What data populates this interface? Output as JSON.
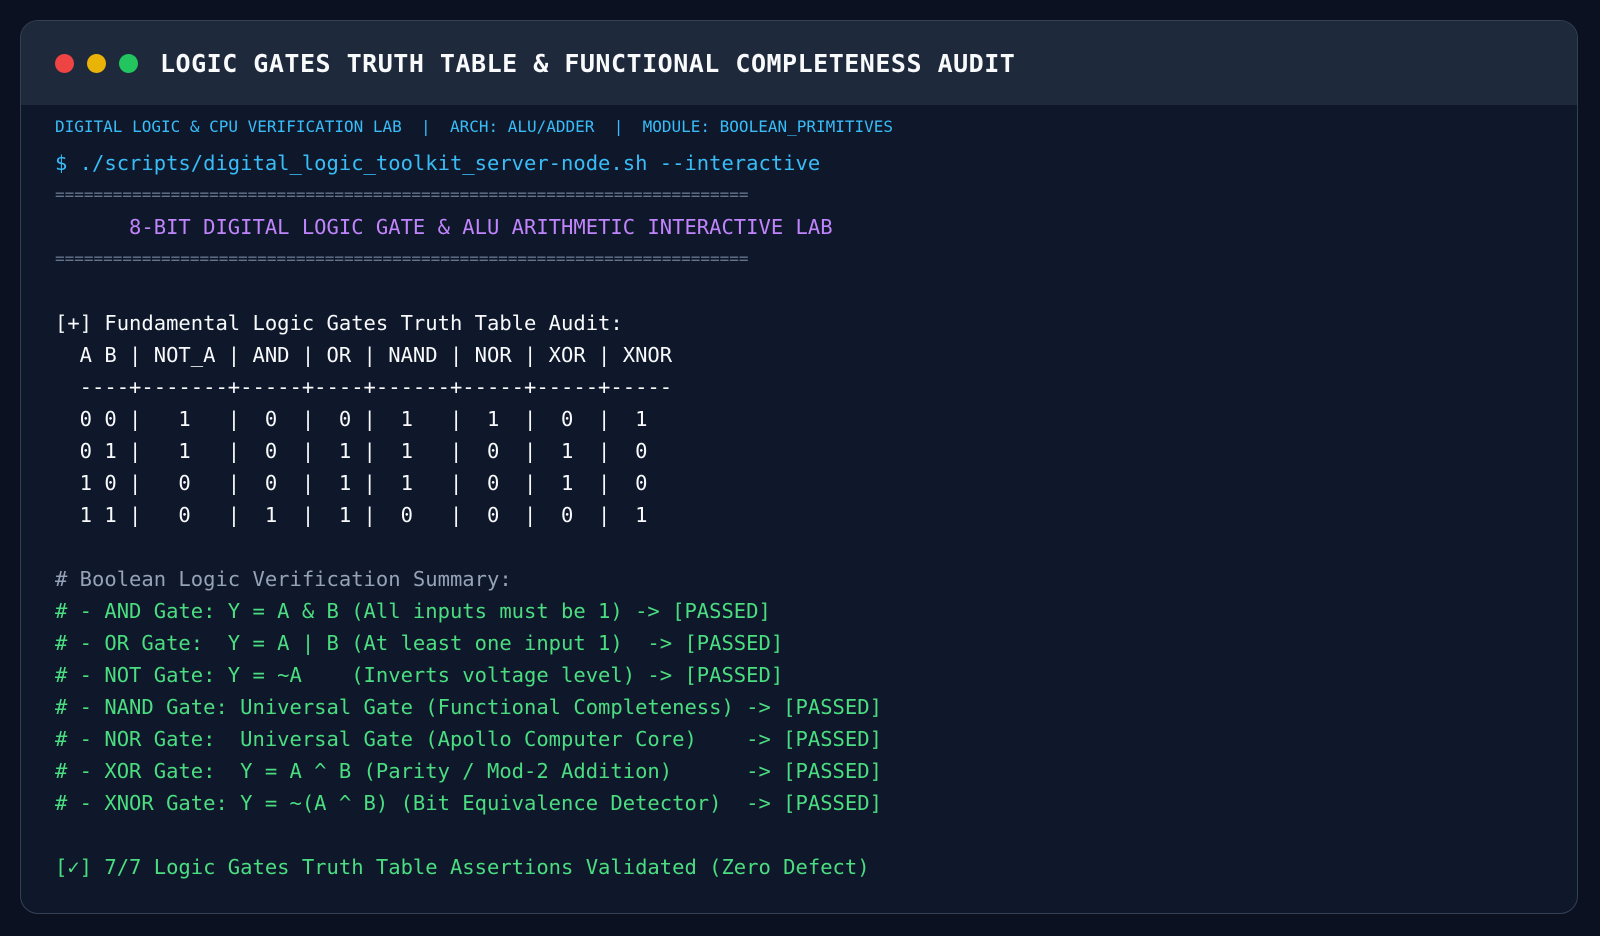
{
  "window": {
    "title": "LOGIC GATES TRUTH TABLE & FUNCTIONAL COMPLETENESS AUDIT",
    "controls": [
      "close",
      "minimize",
      "maximize"
    ]
  },
  "meta": "DIGITAL LOGIC & CPU VERIFICATION LAB  |  ARCH: ALU/ADDER  |  MODULE: BOOLEAN_PRIMITIVES",
  "terminal": {
    "command": "$ ./scripts/digital_logic_toolkit_server-node.sh --interactive",
    "rule": "========================================================================",
    "banner": "      8-BIT DIGITAL LOGIC GATE & ALU ARITHMETIC INTERACTIVE LAB",
    "audit_header": "[+] Fundamental Logic Gates Truth Table Audit:",
    "table_header": "  A B | NOT_A | AND | OR | NAND | NOR | XOR | XNOR",
    "table_sep": "  ----+-------+-----+----+------+-----+-----+-----",
    "table_rows": [
      "  0 0 |   1   |  0  |  0 |  1   |  1  |  0  |  1",
      "  0 1 |   1   |  0  |  1 |  1   |  0  |  1  |  0",
      "  1 0 |   0   |  0  |  1 |  1   |  0  |  1  |  0",
      "  1 1 |   0   |  1  |  1 |  0   |  0  |  0  |  1"
    ],
    "summary_header": "# Boolean Logic Verification Summary:",
    "summary_lines": [
      "# - AND Gate: Y = A & B (All inputs must be 1) -> [PASSED]",
      "# - OR Gate:  Y = A | B (At least one input 1)  -> [PASSED]",
      "# - NOT Gate: Y = ~A    (Inverts voltage level) -> [PASSED]",
      "# - NAND Gate: Universal Gate (Functional Completeness) -> [PASSED]",
      "# - NOR Gate:  Universal Gate (Apollo Computer Core)    -> [PASSED]",
      "# - XOR Gate:  Y = A ^ B (Parity / Mod-2 Addition)      -> [PASSED]",
      "# - XNOR Gate: Y = ~(A ^ B) (Bit Equivalence Detector)  -> [PASSED]"
    ],
    "result": "[✓] 7/7 Logic Gates Truth Table Assertions Validated (Zero Defect)"
  },
  "colors": {
    "background": "#0f172a",
    "titlebar": "#1e293b",
    "command": "#38bdf8",
    "banner": "#c084fc",
    "pass": "#4ade80",
    "comment": "#94a3b8"
  }
}
